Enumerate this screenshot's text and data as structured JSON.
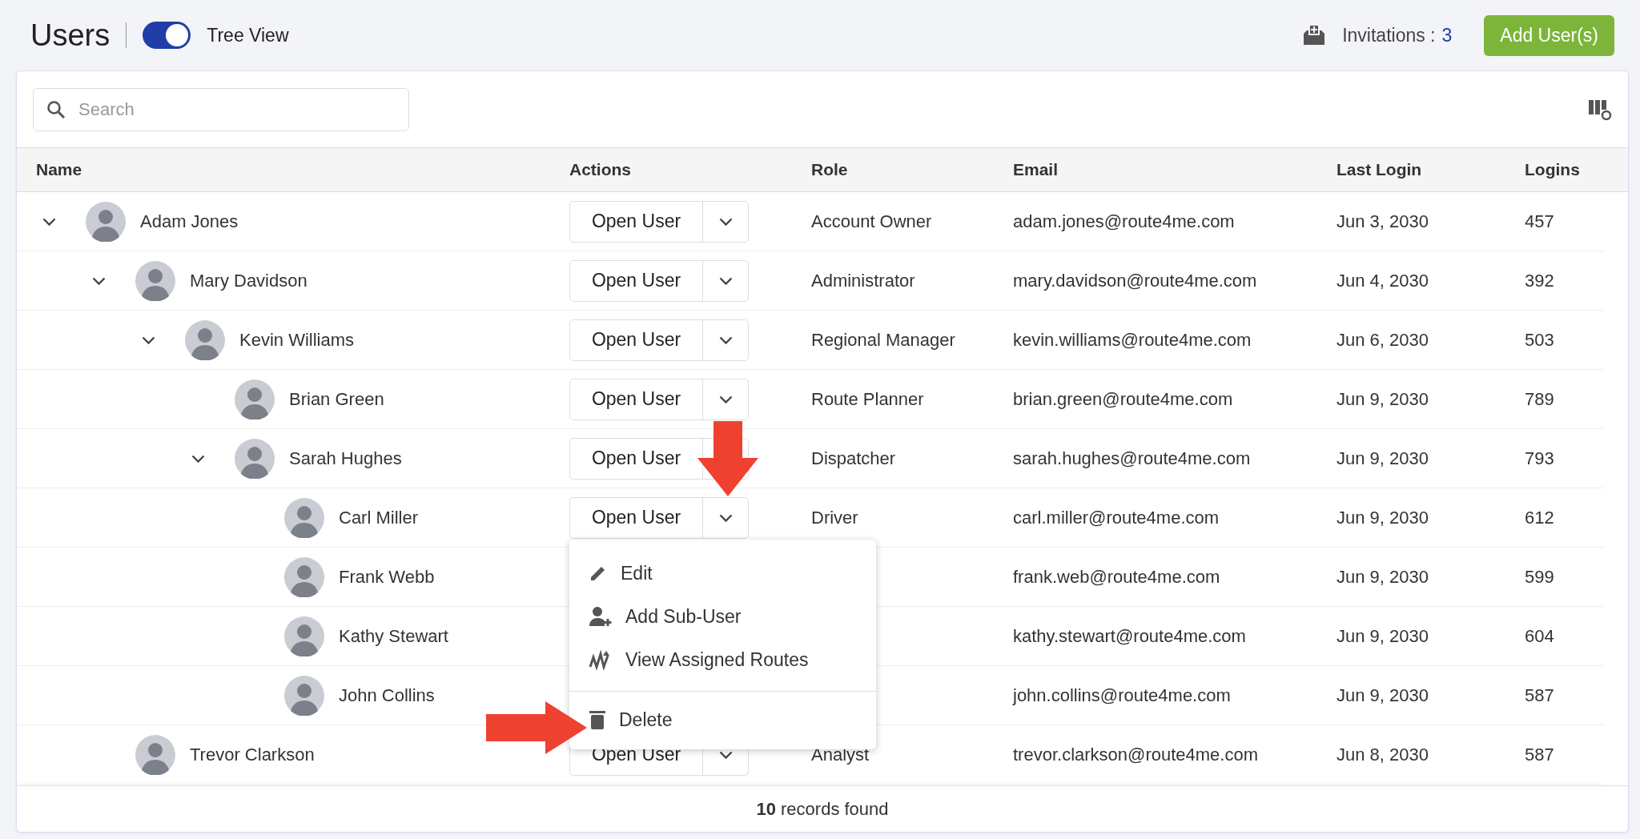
{
  "header": {
    "title": "Users",
    "tree_view": {
      "label": "Tree View",
      "on": true
    },
    "invitations": {
      "label": "Invitations :",
      "count": "3"
    },
    "add_button": "Add User(s)"
  },
  "search": {
    "placeholder": "Search"
  },
  "table": {
    "columns": [
      "Name",
      "Actions",
      "Role",
      "Email",
      "Last Login",
      "Logins"
    ],
    "rows": [
      {
        "name": "Adam Jones",
        "action": "Open User",
        "role": "Account Owner",
        "email": "adam.jones@route4me.com",
        "last_login": "Jun 3, 2030",
        "logins": "457",
        "expanded": true,
        "children": [
          {
            "name": "Mary Davidson",
            "action": "Open User",
            "role": "Administrator",
            "email": "mary.davidson@route4me.com",
            "last_login": "Jun 4, 2030",
            "logins": "392",
            "expanded": true,
            "children": [
              {
                "name": "Kevin Williams",
                "action": "Open User",
                "role": "Regional Manager",
                "email": "kevin.williams@route4me.com",
                "last_login": "Jun 6, 2030",
                "logins": "503",
                "expanded": true,
                "children": [
                  {
                    "name": "Brian Green",
                    "action": "Open User",
                    "role": "Route Planner",
                    "email": "brian.green@route4me.com",
                    "last_login": "Jun 9, 2030",
                    "logins": "789"
                  },
                  {
                    "name": "Sarah Hughes",
                    "action": "Open User",
                    "role": "Dispatcher",
                    "email": "sarah.hughes@route4me.com",
                    "last_login": "Jun 9, 2030",
                    "logins": "793",
                    "expanded": true,
                    "children": [
                      {
                        "name": "Carl Miller",
                        "action": "Open User",
                        "role": "Driver",
                        "email": "carl.miller@route4me.com",
                        "last_login": "Jun 9, 2030",
                        "logins": "612",
                        "menu": [
                          {
                            "kind": "edit",
                            "label": "Edit"
                          },
                          {
                            "kind": "add-user",
                            "label": "Add Sub-User"
                          },
                          {
                            "kind": "routes",
                            "label": "View Assigned Routes"
                          },
                          {
                            "kind": "delete",
                            "label": "Delete"
                          }
                        ]
                      },
                      {
                        "name": "Frank Webb",
                        "email": "frank.web@route4me.com",
                        "last_login": "Jun 9, 2030",
                        "logins": "599"
                      },
                      {
                        "name": "Kathy Stewart",
                        "email": "kathy.stewart@route4me.com",
                        "last_login": "Jun 9, 2030",
                        "logins": "604"
                      },
                      {
                        "name": "John Collins",
                        "email": "john.collins@route4me.com",
                        "last_login": "Jun 9, 2030",
                        "logins": "587"
                      }
                    ]
                  }
                ]
              }
            ]
          },
          {
            "name": "Trevor Clarkson",
            "action": "Open User",
            "role": "Analyst",
            "email": "trevor.clarkson@route4me.com",
            "last_login": "Jun 8, 2030",
            "logins": "587"
          }
        ]
      }
    ]
  },
  "footer": {
    "count": "10",
    "text": "records found"
  }
}
